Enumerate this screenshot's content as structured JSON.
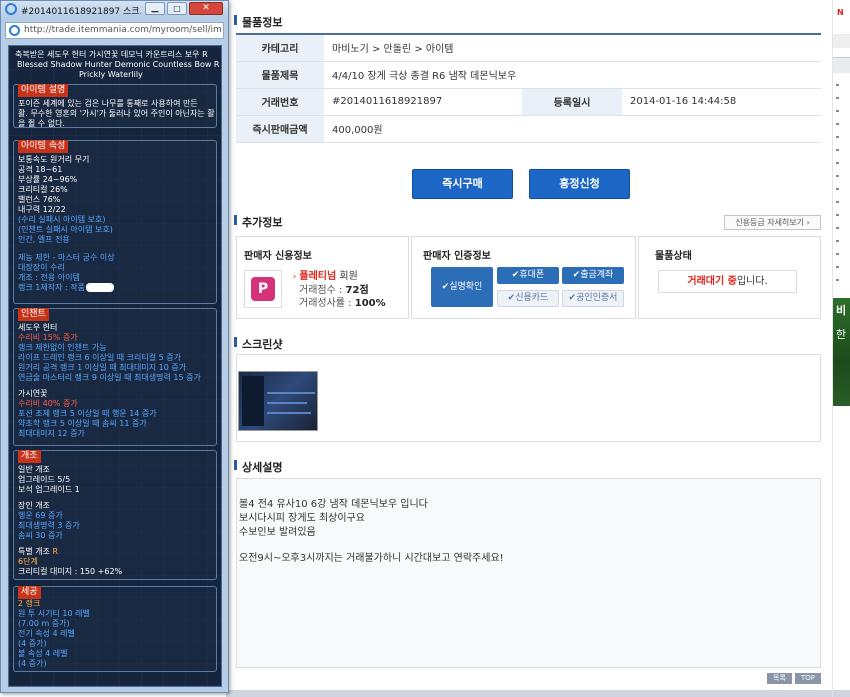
{
  "colors": {
    "accent_blue": "#1c66c6",
    "header_line": "#4a6e9e",
    "label_bg": "#eaf0f7",
    "red_text": "#e0261e",
    "tooltip_bg": "#16253e"
  },
  "goods_info": {
    "section_title": "물품정보",
    "rows": [
      {
        "label": "카테고리",
        "value": "마비노기 > 만돌린 > 아이템"
      },
      {
        "label": "물품제목",
        "value": "4/4/10 장게 극상 종결 R6 냄작 데몬닉보우"
      },
      {
        "label": "거래번호",
        "value": "#2014011618921897",
        "label2": "등록일시",
        "value2": "2014-01-16 14:44:58"
      },
      {
        "label": "즉시판매금액",
        "value": "400,000원"
      }
    ]
  },
  "actions": {
    "buy_now": "즉시구매",
    "negotiate": "흥정신청"
  },
  "extra": {
    "section_title": "추가정보",
    "credit_link": "신용등급 자세히보기 ›",
    "seller_credit": {
      "title": "판매자 신용정보",
      "grade": "플레티넘",
      "grade_suffix": "회원",
      "score_label": "거래점수 : ",
      "score_value": "72점",
      "success_label": "거래성사률 : ",
      "success_value": "100%"
    },
    "seller_auth": {
      "title": "판매자 인증정보",
      "realname": "실명확인",
      "phone": "휴대폰",
      "account": "출금계좌",
      "credit_card": "신용카드",
      "cert": "공인인증서"
    },
    "status": {
      "title": "물품상태",
      "value_red": "거래대기 중",
      "value_suffix": "입니다."
    }
  },
  "screenshot_title": "스크린샷",
  "detail": {
    "section_title": "상세설명",
    "lines": [
      "볼4 전4 유사10 6강 냄작 데몬닉보우 입니다",
      "보시다시피 장게도 최상이구요",
      "수보인보 발려있음",
      "오전9시~오후3시까지는 거래불가하니 시간대보고 연락주세요!"
    ]
  },
  "footer": {
    "list_btn": "목록",
    "top_btn": "TOP"
  },
  "right_edge": {
    "char1": "N",
    "char2": "비",
    "char3": "한"
  },
  "popup": {
    "title": "#2014011618921897 스크...",
    "url": "http://trade.itemmania.com/myroom/sell/ima",
    "item_name_ko": "축복받은 세도우 헌터 가시연꽃 데모닉 카운트리스 보우 R",
    "item_name_en_1": "Blessed Shadow Hunter Demonic Countless Bow R of",
    "item_name_en_2": "Prickly Waterlily",
    "desc_label": "아이템 설명",
    "desc_1": "포이즌 세계에 있는 검은 나무를 통째로 사용하여 만든",
    "desc_2": "활. 무수한 영혼의 '가시'가 둘러나 있어 주인이 아닌자는 활",
    "desc_3": "을 쥘 수 없다.",
    "attr_label": "아이템 속성",
    "attrs": [
      "보통속도 원거리 무기",
      "공격 18~61",
      "부상률 24~96%",
      "크리티컬 26%",
      "밸런스 76%",
      "내구력 12/22"
    ],
    "attrs_blue": [
      "(수리 실패시 아이템 보호)",
      "(인챈트 실패시 아이템 보호)",
      "인간, 엘프 전용"
    ],
    "attrs_blue2": [
      "재능 제한 - 마스터 궁수 이상",
      "대장장이 수리",
      "개조 : 전용 아이템",
      "랭크 1제작자 : 작품"
    ],
    "enchant_label": "인챈트",
    "enchant1_name": "세도우 헌터",
    "enchant1_rank": "수리비 15% 증가",
    "enchant1_lines": [
      "랭크 제한없이 인챈트 가능",
      "라이프 드레인 랭크 6 이상일 때 크리티컬 5 증가",
      "원거리 공격 랭크 1 이상일 때 최대대미지 10 증가",
      "연금술 마스터리 랭크 9 이상일 때 최대생명력 15 증가"
    ],
    "enchant2_name": "가시연꽃",
    "enchant2_rank": "수리비 40% 증가",
    "enchant2_lines": [
      "포션 조제 랭크 5 이상일 때 행운 14 증가",
      "약초학 랭크 5 이상일 때 솜씨 11 증가",
      "최대대미지 12 증가"
    ],
    "mod_label": "개조",
    "mod_general": "일반 개조",
    "mod_upgrade": "업그레이드 5/5",
    "mod_gem": "보석 업그레이드 1",
    "mod_craft": "장인 개조",
    "mod_craft_lines": [
      "행운 69 증가",
      "최대생명력 3 증가",
      "솜씨 30 증가"
    ],
    "mod_special": "특별 개조",
    "mod_special_r": "R",
    "mod_special_lines": [
      "6단계",
      "크리티컬 대미지 : 150 +62%"
    ],
    "setting_label": "세공",
    "setting_rank": "2 랭크",
    "setting_lines": [
      "원 투 시기티 10 레벨",
      "(7.00 m 증가)",
      "전기 속성 4 레벨",
      "(4 증가)",
      "불 속성 4 레벨",
      "(4 증가)"
    ]
  }
}
